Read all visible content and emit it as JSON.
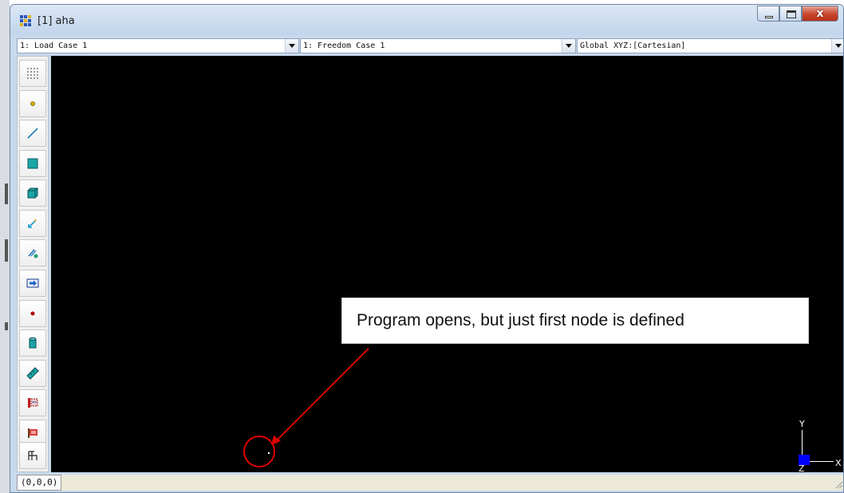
{
  "window": {
    "title": "[1] aha"
  },
  "combos": {
    "load_case": "1: Load Case 1",
    "freedom_case": "1: Freedom Case 1",
    "coordinate_system": "Global XYZ:[Cartesian]"
  },
  "toolbar": {
    "tools": [
      {
        "icon": "grid-icon"
      },
      {
        "icon": "node-icon"
      },
      {
        "icon": "beam-icon"
      },
      {
        "icon": "plate-icon"
      },
      {
        "icon": "brick-icon"
      },
      {
        "icon": "link-icon"
      },
      {
        "icon": "link-node-icon"
      },
      {
        "icon": "load-arrow-icon"
      },
      {
        "icon": "point-mass-icon"
      },
      {
        "icon": "cylinder-icon"
      },
      {
        "icon": "ruler-icon"
      },
      {
        "icon": "attribute-icon"
      },
      {
        "icon": "flag-icon"
      },
      {
        "icon": "restraint-icon"
      }
    ]
  },
  "status": {
    "coordinates": "(0,0,0)"
  },
  "annotation": {
    "text": "Program opens, but just first node is defined",
    "color": "#e00000"
  },
  "axes": {
    "y_label": "Y",
    "z_label": "Z",
    "x_label": "X",
    "z_color": "#0000ff"
  }
}
